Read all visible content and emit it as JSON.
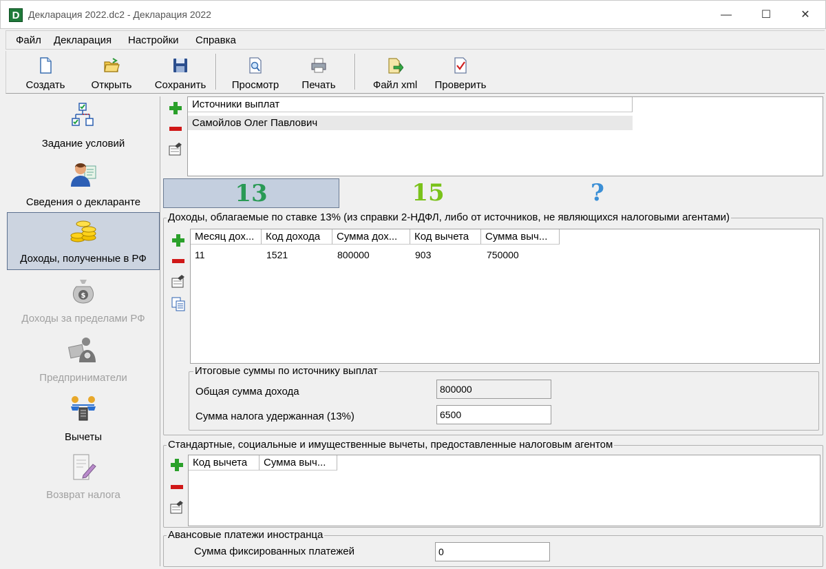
{
  "window": {
    "title": "Декларация 2022.dc2 - Декларация 2022",
    "icon_letter": "D",
    "minimize": "—",
    "maximize": "☐",
    "close": "✕"
  },
  "menu": [
    "Файл",
    "Декларация",
    "Настройки",
    "Справка"
  ],
  "toolbar": {
    "create": "Создать",
    "open": "Открыть",
    "save": "Сохранить",
    "preview": "Просмотр",
    "print": "Печать",
    "xml": "Файл xml",
    "check": "Проверить"
  },
  "nav": [
    {
      "label": "Задание условий",
      "icon": "conditions-icon",
      "enabled": true
    },
    {
      "label": "Сведения о декларанте",
      "icon": "person-icon",
      "enabled": true
    },
    {
      "label": "Доходы, полученные в РФ",
      "icon": "coins-icon",
      "enabled": true,
      "selected": true
    },
    {
      "label": "Доходы за пределами РФ",
      "icon": "money-bag-icon",
      "enabled": false
    },
    {
      "label": "Предприниматели",
      "icon": "entrepreneur-icon",
      "enabled": false
    },
    {
      "label": "Вычеты",
      "icon": "scales-icon",
      "enabled": true
    },
    {
      "label": "Возврат налога",
      "icon": "document-pen-icon",
      "enabled": false
    }
  ],
  "sources": {
    "header": "Источники выплат",
    "rows": [
      "Самойлов Олег Павлович"
    ]
  },
  "tax_tabs": [
    {
      "label": "13",
      "color": "#2a9a55",
      "active": true
    },
    {
      "label": "15",
      "color": "#7ac21a",
      "active": false
    },
    {
      "label": "?",
      "color": "#3b8fd6",
      "active": false
    }
  ],
  "income": {
    "legend": "Доходы, облагаемые по ставке 13% (из справки 2-НДФЛ, либо от источников, не являющихся налоговыми агентами)",
    "columns": [
      "Месяц дох...",
      "Код дохода",
      "Сумма дох...",
      "Код вычета",
      "Сумма выч..."
    ],
    "rows": [
      [
        "11",
        "1521",
        "800000",
        "903",
        "750000"
      ]
    ],
    "totals": {
      "legend": "Итоговые суммы по источнику выплат",
      "total_income_label": "Общая сумма дохода",
      "total_income_value": "800000",
      "tax_withheld_label": "Сумма налога удержанная (13%)",
      "tax_withheld_value": "6500"
    }
  },
  "deductions": {
    "legend": "Стандартные, социальные и имущественные вычеты, предоставленные налоговым агентом",
    "columns": [
      "Код вычета",
      "Сумма выч..."
    ]
  },
  "advance": {
    "legend": "Авансовые платежи иностранца",
    "label": "Сумма фиксированных платежей",
    "value": "0"
  }
}
